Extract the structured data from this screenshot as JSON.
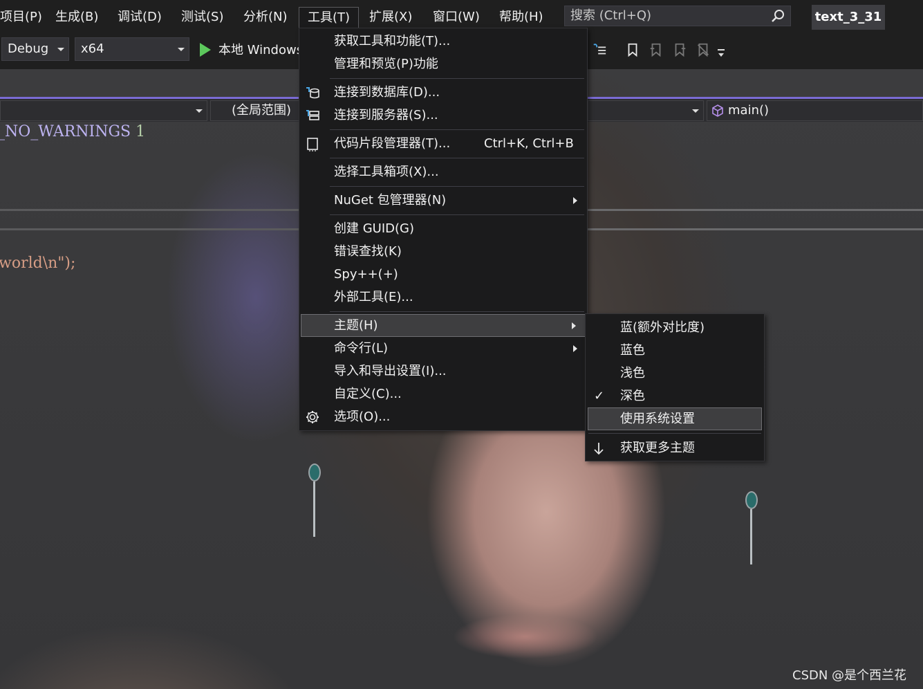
{
  "menubar": {
    "items": [
      "项目(P)",
      "生成(B)",
      "调试(D)",
      "测试(S)",
      "分析(N)",
      "工具(T)",
      "扩展(X)",
      "窗口(W)",
      "帮助(H)"
    ],
    "search_placeholder": "搜索 (Ctrl+Q)",
    "project_name": "text_3_31"
  },
  "toolbar": {
    "configuration": "Debug",
    "platform": "x64",
    "run_label": "本地 Windows 调试器"
  },
  "nav": {
    "scope": "(全局范围)",
    "member": "main()"
  },
  "code": {
    "line1_text": "_NO_WARNINGS",
    "line1_num": "1",
    "line2_text": "world\\n\");"
  },
  "tools_menu": {
    "items": [
      {
        "label": "获取工具和功能(T)...",
        "icon": ""
      },
      {
        "label": "管理和预览(P)功能",
        "icon": ""
      },
      {
        "label": "连接到数据库(D)...",
        "icon": "database-connect-icon"
      },
      {
        "label": "连接到服务器(S)...",
        "icon": "server-connect-icon"
      },
      {
        "label": "代码片段管理器(T)...",
        "shortcut": "Ctrl+K, Ctrl+B",
        "icon": "snippet-icon"
      },
      {
        "label": "选择工具箱项(X)...",
        "icon": ""
      },
      {
        "label": "NuGet 包管理器(N)",
        "submenu": true
      },
      {
        "label": "创建 GUID(G)"
      },
      {
        "label": "错误查找(K)"
      },
      {
        "label": "Spy++(+)"
      },
      {
        "label": "外部工具(E)..."
      },
      {
        "label": "主题(H)",
        "submenu": true,
        "highlighted": true
      },
      {
        "label": "命令行(L)",
        "submenu": true
      },
      {
        "label": "导入和导出设置(I)..."
      },
      {
        "label": "自定义(C)..."
      },
      {
        "label": "选项(O)...",
        "icon": "gear-icon"
      }
    ]
  },
  "theme_menu": {
    "items": [
      {
        "label": "蓝(额外对比度)"
      },
      {
        "label": "蓝色"
      },
      {
        "label": "浅色"
      },
      {
        "label": "深色",
        "checked": true
      },
      {
        "label": "使用系统设置",
        "highlighted": true
      },
      {
        "label": "获取更多主题",
        "icon": "download-arrow-icon"
      }
    ],
    "check_glyph": "✓"
  },
  "watermark": "CSDN @是个西兰花"
}
